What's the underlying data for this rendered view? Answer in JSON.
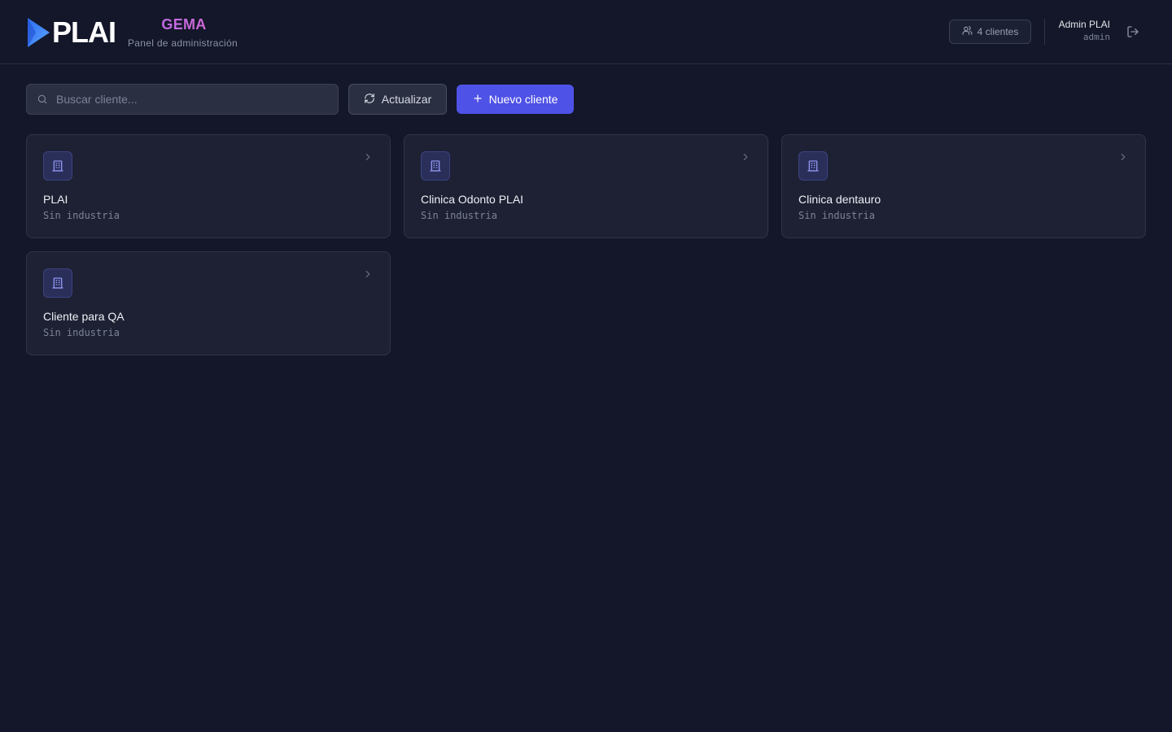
{
  "header": {
    "logo_text": "PLAI",
    "brand_title": "GEMA",
    "brand_subtitle": "Panel de administración",
    "clients_count": "4 clientes",
    "user_name": "Admin PLAI",
    "user_role": "admin",
    "icons": {
      "logo": "play-triangle-icon",
      "clients": "users-icon",
      "logout": "logout-icon"
    }
  },
  "toolbar": {
    "search_placeholder": "Buscar cliente...",
    "search_value": "",
    "refresh_label": "Actualizar",
    "new_client_label": "Nuevo cliente",
    "icons": {
      "search": "search-icon",
      "refresh": "refresh-icon",
      "new": "plus-icon"
    }
  },
  "clients": [
    {
      "name": "PLAI",
      "industry": "Sin industria"
    },
    {
      "name": "Clinica Odonto PLAI",
      "industry": "Sin industria"
    },
    {
      "name": "Clinica dentauro",
      "industry": "Sin industria"
    },
    {
      "name": "Cliente para QA",
      "industry": "Sin industria"
    }
  ],
  "card_icons": {
    "client": "building-icon",
    "open": "chevron-right-icon"
  },
  "colors": {
    "background": "#131729",
    "card": "#1d2133",
    "accent": "#4f52e6",
    "brand_gradient_start": "#b16cf0",
    "brand_gradient_end": "#e066c8",
    "logo_gradient_start": "#2f6bf0",
    "logo_gradient_end": "#5aa6ff"
  }
}
